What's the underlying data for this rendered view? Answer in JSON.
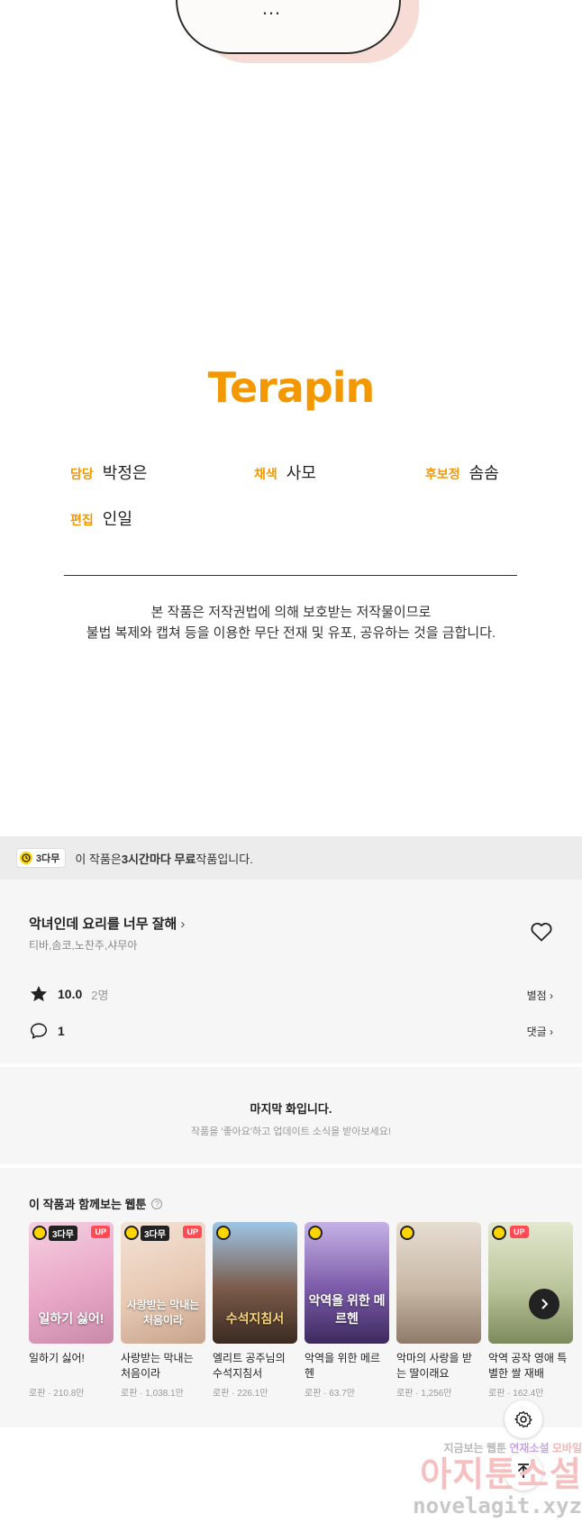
{
  "bubble": {
    "text": "…"
  },
  "credits": {
    "logo": "Terapin",
    "items": [
      {
        "key": "담당",
        "value": "박정은"
      },
      {
        "key": "채색",
        "value": "사모"
      },
      {
        "key": "후보정",
        "value": "솜솜"
      },
      {
        "key": "편집",
        "value": "인일"
      }
    ],
    "notice_line1": "본 작품은 저작권법에 의해 보호받는 저작물이므로",
    "notice_line2": "불법 복제와 캡쳐 등을 이용한 무단 전재 및 유포, 공유하는 것을 금합니다."
  },
  "free_banner": {
    "badge": "3다무",
    "text_pre": "이 작품은 ",
    "text_bold": "3시간마다 무료",
    "text_post": " 작품입니다."
  },
  "work": {
    "title": "악녀인데 요리를 너무 잘해",
    "authors": "티바,솜코,노찬주,샤무아",
    "rating": "10.0",
    "rating_count": "2명",
    "rating_link": "별점",
    "comments": "1",
    "comments_link": "댓글"
  },
  "last_episode": {
    "title": "마지막 화입니다.",
    "subtitle": "작품을 '좋아요'하고 업데이트 소식을 받아보세요!"
  },
  "recommend": {
    "title": "이 작품과 함께보는 웹툰",
    "cards": [
      {
        "name": "일하기 싫어!",
        "meta": "로판 · 210.8만",
        "free": "3다무",
        "up": "UP",
        "art": "일하기 싫어!",
        "color": "#e9a7c6"
      },
      {
        "name": "사랑받는 막내는 처음이라",
        "meta": "로판 · 1,038.1만",
        "free": "3다무",
        "up": "UP",
        "art": "사랑받는 막내는 처음이라",
        "color": "#e7c9b3"
      },
      {
        "name": "엘리트 공주님의 수석지침서",
        "meta": "로판 · 226.1만",
        "free": "",
        "up": "",
        "art": "수석지침서",
        "color": "#7a5a4a"
      },
      {
        "name": "악역을 위한 메르헨",
        "meta": "로판 · 63.7만",
        "free": "",
        "up": "",
        "art": "악역을 위한 메르헨",
        "color": "#7b5aa8"
      },
      {
        "name": "악마의 사랑을 받는 딸이래요",
        "meta": "로판 · 1,256만",
        "free": "",
        "up": "",
        "art": "",
        "color": "#c9b8a6"
      },
      {
        "name": "악역 공작 영애 특별한 쌀 재배",
        "meta": "로판 · 162.4만",
        "free": "",
        "up": "UP",
        "art": "",
        "color": "#b9c49a"
      }
    ]
  },
  "watermark": {
    "line1a": "지금보는 웹툰",
    "line1b": "연재소설",
    "line1c": "모바일",
    "line2": "아지툰소설",
    "line3": "novelagit.xyz"
  },
  "colors": {
    "accent": "#f39800",
    "badge_yellow": "#ffd500",
    "up_red": "#ff4b55"
  },
  "icons": [
    "clock-icon",
    "heart-icon",
    "star-icon",
    "comment-icon",
    "chevron-right-icon",
    "help-icon",
    "gear-icon",
    "arrow-up-icon"
  ]
}
